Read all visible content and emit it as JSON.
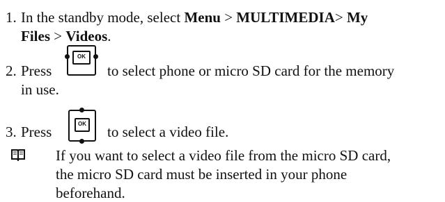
{
  "steps": [
    {
      "num": "1.",
      "lines": [
        {
          "segments": [
            {
              "text": "In the standby mode, select ",
              "bold": false
            },
            {
              "text": "Menu",
              "bold": true
            },
            {
              "text": " > ",
              "bold": false
            },
            {
              "text": "MULTIMEDIA",
              "bold": true
            },
            {
              "text": "> ",
              "bold": false
            },
            {
              "text": "My",
              "bold": true
            }
          ]
        },
        {
          "segments": [
            {
              "text": "Files",
              "bold": true
            },
            {
              "text": " > ",
              "bold": false
            },
            {
              "text": "Videos",
              "bold": true
            },
            {
              "text": ".",
              "bold": false
            }
          ]
        }
      ]
    },
    {
      "num": "2.",
      "prefix": "Press",
      "icon": "ok-left-right-key-icon",
      "icon_label": "OK",
      "suffix": "to select phone or micro SD card for the memory",
      "line2": "in use."
    },
    {
      "num": "3.",
      "prefix": "Press",
      "icon": "ok-up-down-key-icon",
      "icon_label": "OK",
      "suffix": "to select a video file."
    }
  ],
  "note": {
    "icon": "book-note-icon",
    "lines": [
      "If you want to select a video file from the micro SD card,",
      "the micro SD card must be inserted in your phone",
      "beforehand."
    ]
  }
}
